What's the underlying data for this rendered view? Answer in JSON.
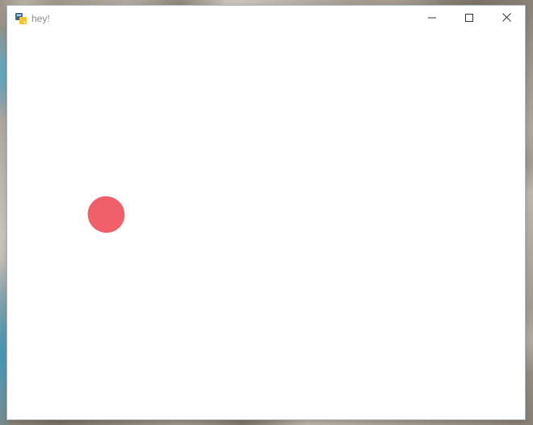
{
  "window": {
    "title": "hey!",
    "icon": "python-icon",
    "controls": [
      "minimize-icon",
      "maximize-icon",
      "close-icon"
    ]
  },
  "canvas": {
    "background": "#ffffff",
    "ball": {
      "shape": "ellipse",
      "color": "#f0606a"
    }
  }
}
